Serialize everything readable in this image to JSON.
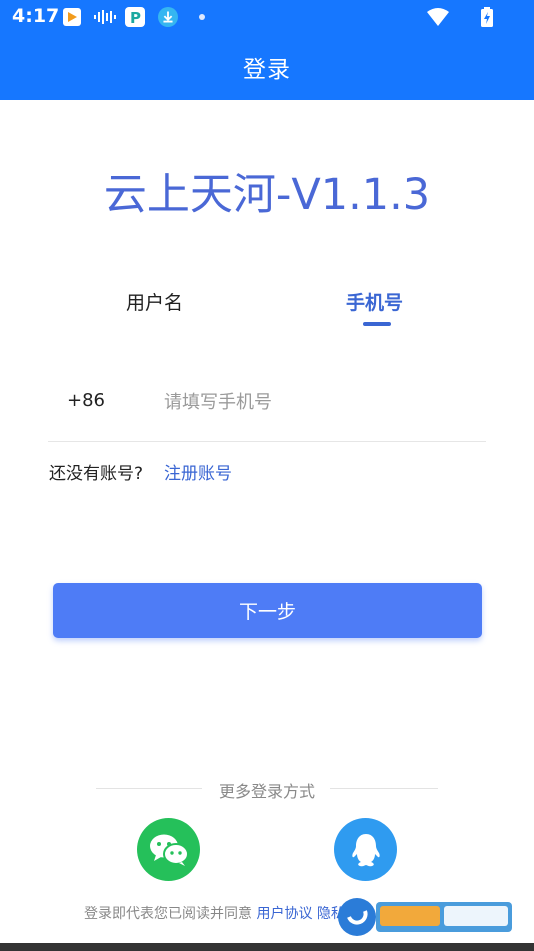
{
  "status_bar": {
    "time": "4:17",
    "icons": [
      "play-store-icon",
      "audio-wave-icon",
      "parking-app-icon",
      "download-icon",
      "notification-dot-icon",
      "wifi-icon",
      "battery-charging-icon"
    ]
  },
  "header": {
    "title": "登录"
  },
  "app_name": "云上天河-V1.1.3",
  "tabs": [
    {
      "label": "用户名",
      "active": false
    },
    {
      "label": "手机号",
      "active": true
    }
  ],
  "phone": {
    "country_code": "+86",
    "placeholder": "请填写手机号",
    "value": ""
  },
  "register": {
    "prompt": "还没有账号?",
    "link": "注册账号"
  },
  "next_button": "下一步",
  "more_methods": {
    "label": "更多登录方式",
    "options": [
      "wechat-icon",
      "qq-icon"
    ]
  },
  "agreement": {
    "prefix": "登录即代表您已阅读并同意",
    "user_agreement": "用户协议",
    "privacy": "隐私政策"
  },
  "colors": {
    "header_bg": "#1677ff",
    "accent": "#3a66d3",
    "button": "#4e7cf6",
    "wechat": "#25c05a",
    "qq": "#2f9bf0"
  }
}
